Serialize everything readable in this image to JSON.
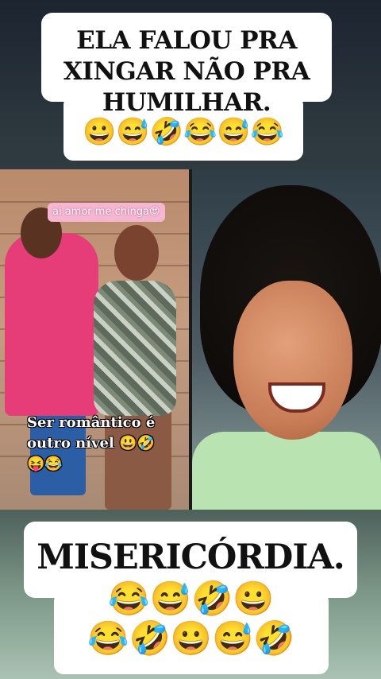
{
  "top_caption": {
    "text": "ELA FALOU PRA XINGAR NÃO PRA HUMILHAR.",
    "emojis": "😀😅🤣😂😅😂"
  },
  "video": {
    "left_panel": {
      "sticker_text": "ai amor me chinga😍",
      "overlay_line1": "Ser romântico é",
      "overlay_line2": "outro nível 😃🤣",
      "overlay_line3": "😝😂"
    }
  },
  "bottom_caption": {
    "text": "MISERICÓRDIA.",
    "emojis_line1": "😂😅🤣😀",
    "emojis_line2": "😂🤣😀😅🤣"
  },
  "colors": {
    "caption_bg": "#ffffff",
    "caption_text": "#111111",
    "sticker_bg": "#f4b6d0",
    "shirt_pink": "#e63d78",
    "shirt_green": "#b9e3b1"
  }
}
